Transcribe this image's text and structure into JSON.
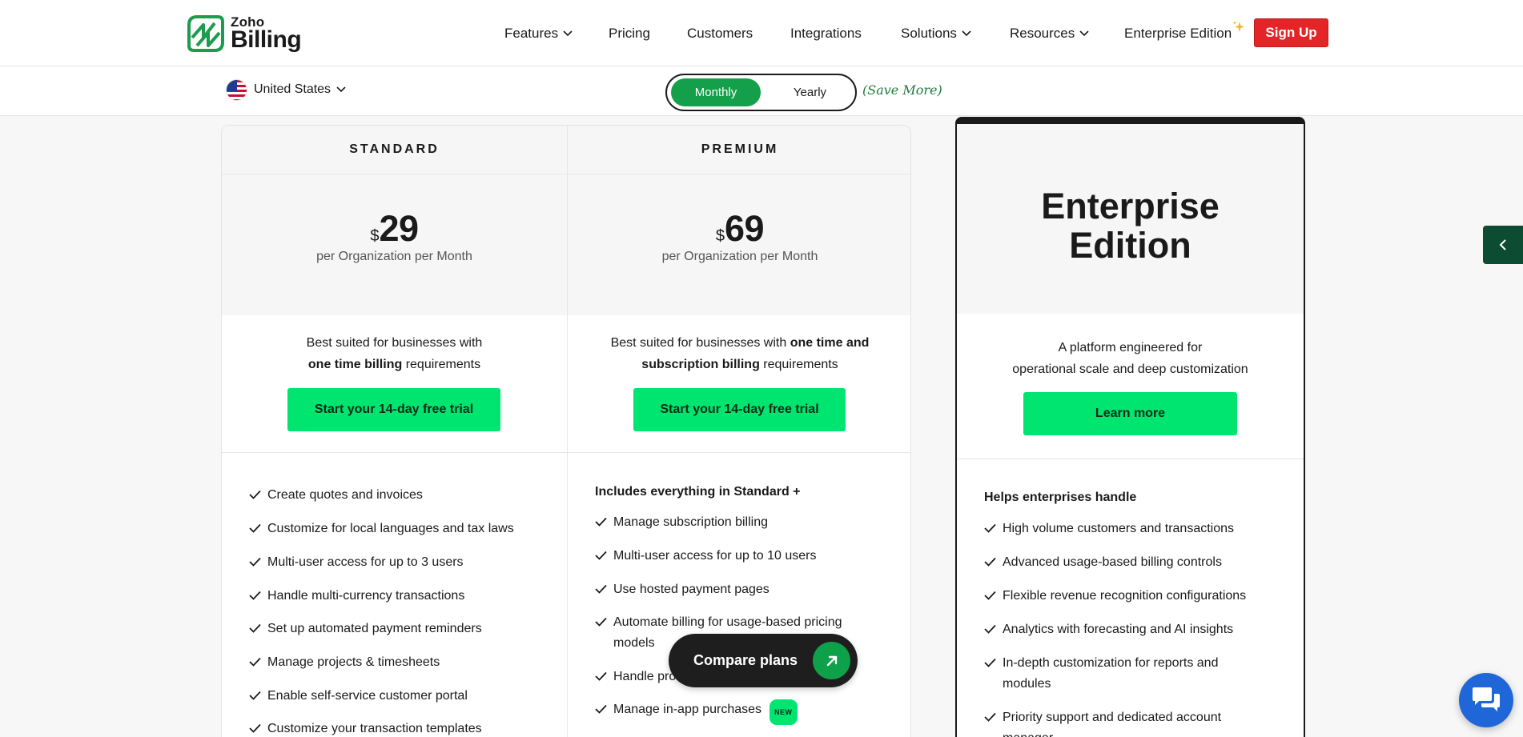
{
  "logo": {
    "brand": "Zoho",
    "product": "Billing",
    "icon": "zoho-billing-logo-icon"
  },
  "nav": {
    "items": [
      {
        "label": "Features",
        "has_dropdown": true
      },
      {
        "label": "Pricing",
        "has_dropdown": false
      },
      {
        "label": "Customers",
        "has_dropdown": false
      },
      {
        "label": "Integrations",
        "has_dropdown": false
      },
      {
        "label": "Solutions",
        "has_dropdown": true
      },
      {
        "label": "Resources",
        "has_dropdown": true
      },
      {
        "label": "Enterprise Edition",
        "has_dropdown": false
      }
    ],
    "signup_label": "Sign Up"
  },
  "subbar": {
    "country": "United States",
    "billing_toggle": {
      "monthly": "Monthly",
      "yearly": "Yearly",
      "selected": "Monthly"
    },
    "save_more": "(Save More)"
  },
  "plans": {
    "standard": {
      "name": "STANDARD",
      "currency": "$",
      "price": "29",
      "period": "per Organization per Month",
      "desc_line1": "Best suited for businesses with",
      "desc_bold": "one time billing",
      "desc_tail": " requirements",
      "cta": "Start your 14-day free trial",
      "features": [
        "Create quotes and invoices",
        "Customize for local languages and tax laws",
        "Multi-user access for up to 3 users",
        "Handle multi-currency transactions",
        "Set up automated payment reminders",
        "Manage projects & timesheets",
        "Enable self-service customer portal",
        "Customize your transaction templates"
      ]
    },
    "premium": {
      "name": "PREMIUM",
      "currency": "$",
      "price": "69",
      "period": "per Organization per Month",
      "desc_lead": "Best suited for businesses with ",
      "desc_bold1": "one time and",
      "desc_bold2": "subscription billing",
      "desc_tail": " requirements",
      "cta": "Start your 14-day free trial",
      "features_heading": "Includes everything in Standard +",
      "features": [
        "Manage subscription billing",
        "Multi-user access for up to 10 users",
        "Use hosted payment pages",
        "Automate billing for usage-based pricing models",
        "Handle pro",
        "Manage in-app purchases"
      ],
      "new_badge": "NEW"
    },
    "enterprise": {
      "title_line1": "Enterprise",
      "title_line2": "Edition",
      "desc_line1": "A platform engineered for",
      "desc_line2": "operational scale and deep customization",
      "cta": "Learn more",
      "features_heading": "Helps enterprises handle",
      "features": [
        "High volume customers and transactions",
        "Advanced usage-based billing controls",
        "Flexible revenue recognition configurations",
        "Analytics with forecasting and AI insights",
        "In-depth customization for reports and modules",
        "Priority support and dedicated account manager"
      ]
    }
  },
  "compare_plans": "Compare plans",
  "colors": {
    "accent_green": "#00e56f",
    "toggle_green": "#149f4b",
    "signup_red": "#e42527",
    "dark": "#1a1a1a",
    "side_tab": "#0c4c33",
    "chat_blue": "#1f67d8"
  }
}
